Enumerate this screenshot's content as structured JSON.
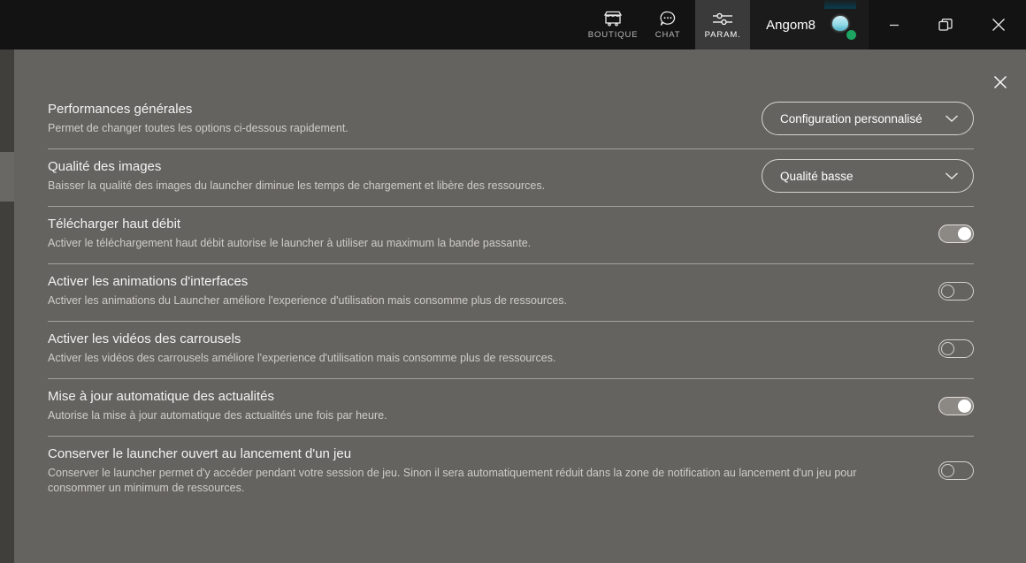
{
  "titlebar": {
    "nav_tabs": [
      {
        "label": "BOUTIQUE",
        "icon": "shop-icon",
        "active": false
      },
      {
        "label": "CHAT",
        "icon": "chat-bubble-icon",
        "active": false
      },
      {
        "label": "PARAM.",
        "icon": "sliders-icon",
        "active": true
      }
    ],
    "account": {
      "name": "Angom8",
      "avatar": "user-avatar",
      "status": "online",
      "status_color": "#1da462"
    },
    "window_controls": [
      {
        "name": "minimize",
        "glyph": "minimize-icon"
      },
      {
        "name": "restore",
        "glyph": "restore-icon"
      },
      {
        "name": "close",
        "glyph": "close-icon"
      }
    ]
  },
  "panel": {
    "close_label": "close-icon",
    "background_color": "#656360"
  },
  "settings": [
    {
      "title": "Performances générales",
      "desc": "Permet de changer toutes les options ci-dessous rapidement.",
      "control": "dropdown",
      "value": "Configuration personnalisé"
    },
    {
      "title": "Qualité des images",
      "desc": "Baisser la qualité des images du launcher diminue les temps de chargement et libère des ressources.",
      "control": "dropdown",
      "value": "Qualité basse"
    },
    {
      "title": "Télécharger haut débit",
      "desc": "Activer le téléchargement haut débit autorise le launcher à utiliser au maximum la bande passante.",
      "control": "toggle",
      "value": "on"
    },
    {
      "title": "Activer les animations d'interfaces",
      "desc": "Activer les animations du Launcher améliore l'experience d'utilisation mais consomme plus de ressources.",
      "control": "toggle",
      "value": "off"
    },
    {
      "title": "Activer les vidéos des carrousels",
      "desc": "Activer les vidéos des carrousels améliore l'experience d'utilisation mais consomme plus de ressources.",
      "control": "toggle",
      "value": "off"
    },
    {
      "title": "Mise à jour automatique des actualités",
      "desc": "Autorise la mise à jour automatique des actualités une fois par heure.",
      "control": "toggle",
      "value": "on"
    },
    {
      "title": "Conserver le launcher ouvert au lancement d'un jeu",
      "desc": "Conserver le launcher permet d'y accéder pendant votre session de jeu. Sinon il sera automatiquement réduit dans la zone de notification au lancement d'un jeu pour consommer un minimum de ressources.",
      "control": "toggle",
      "value": "off"
    }
  ]
}
